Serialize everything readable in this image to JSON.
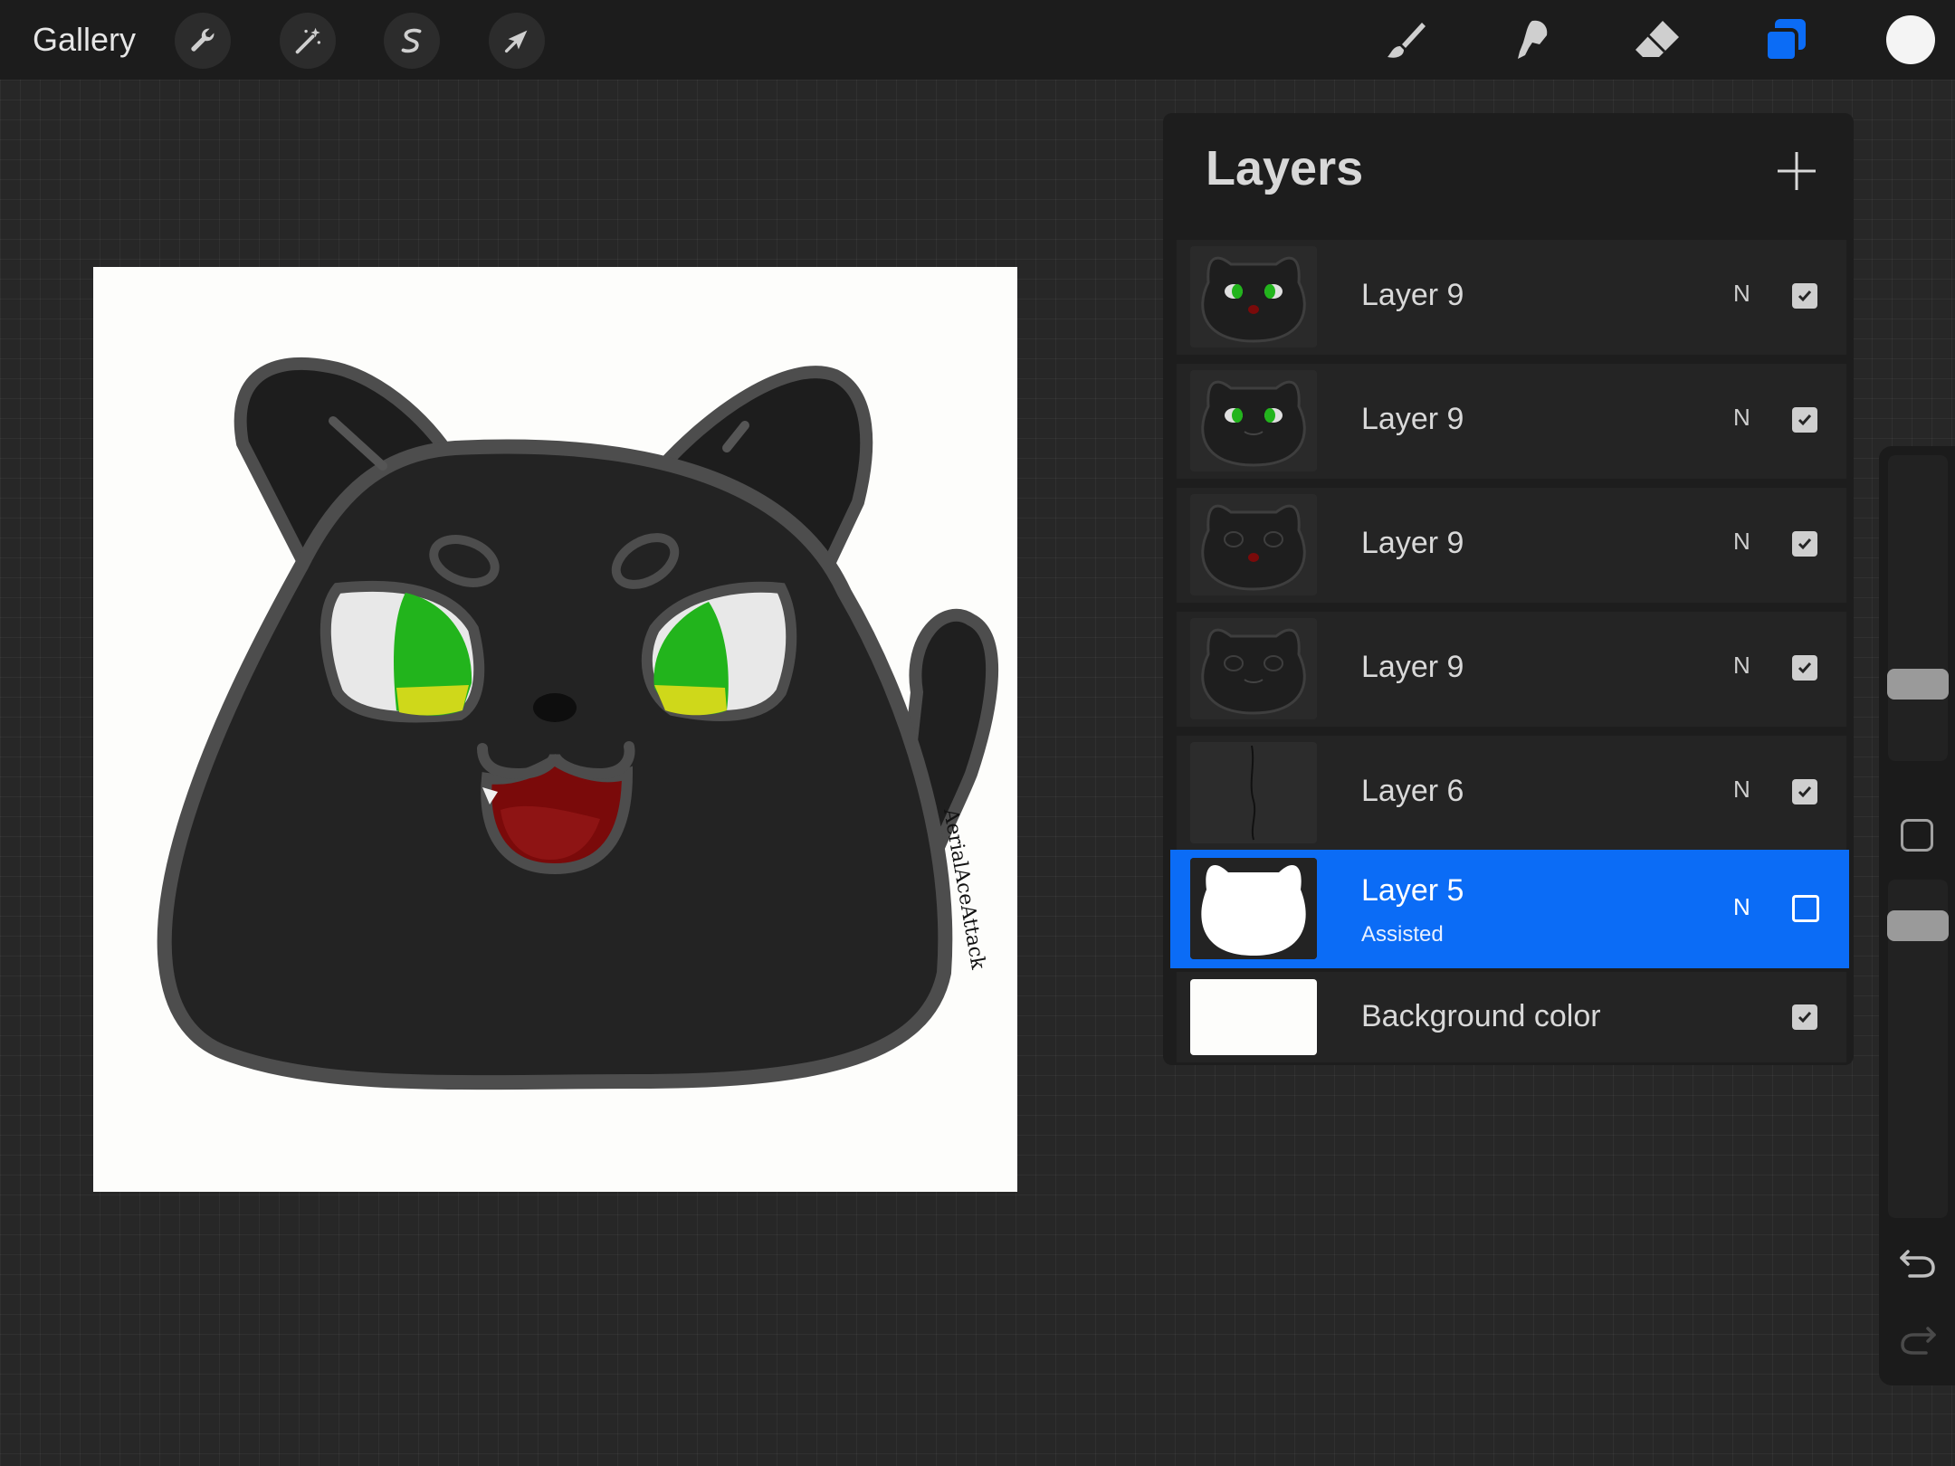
{
  "toolbar": {
    "gallery_label": "Gallery",
    "left_tools": [
      {
        "name": "actions",
        "icon": "wrench-icon"
      },
      {
        "name": "adjustments",
        "icon": "magic-wand-icon"
      },
      {
        "name": "selection",
        "icon": "selection-s-icon"
      },
      {
        "name": "transform",
        "icon": "arrow-cursor-icon"
      }
    ],
    "right_tools": [
      {
        "name": "brush",
        "icon": "brush-icon"
      },
      {
        "name": "smudge",
        "icon": "smudge-finger-icon"
      },
      {
        "name": "eraser",
        "icon": "eraser-icon"
      },
      {
        "name": "layers",
        "icon": "layers-icon",
        "active": true
      }
    ],
    "current_color": "#f4f4f4"
  },
  "artwork": {
    "signature_text": "AerialAceAttack"
  },
  "layers_panel": {
    "title": "Layers",
    "add_icon": "plus-icon",
    "layers": [
      {
        "name": "Layer 9",
        "blend": "N",
        "visible": true,
        "selected": false
      },
      {
        "name": "Layer 9",
        "blend": "N",
        "visible": true,
        "selected": false
      },
      {
        "name": "Layer 9",
        "blend": "N",
        "visible": true,
        "selected": false
      },
      {
        "name": "Layer 9",
        "blend": "N",
        "visible": true,
        "selected": false
      },
      {
        "name": "Layer 6",
        "blend": "N",
        "visible": true,
        "selected": false
      },
      {
        "name": "Layer 5",
        "subtitle": "Assisted",
        "blend": "N",
        "visible": false,
        "selected": true
      },
      {
        "name": "Background color",
        "visible": true,
        "selected": false
      }
    ]
  },
  "colors": {
    "accent": "#0b6cf6",
    "cat_body": "#222222",
    "eye_green": "#22b41c",
    "eye_yellow": "#cfd81a",
    "mouth": "#7a0a0a"
  }
}
